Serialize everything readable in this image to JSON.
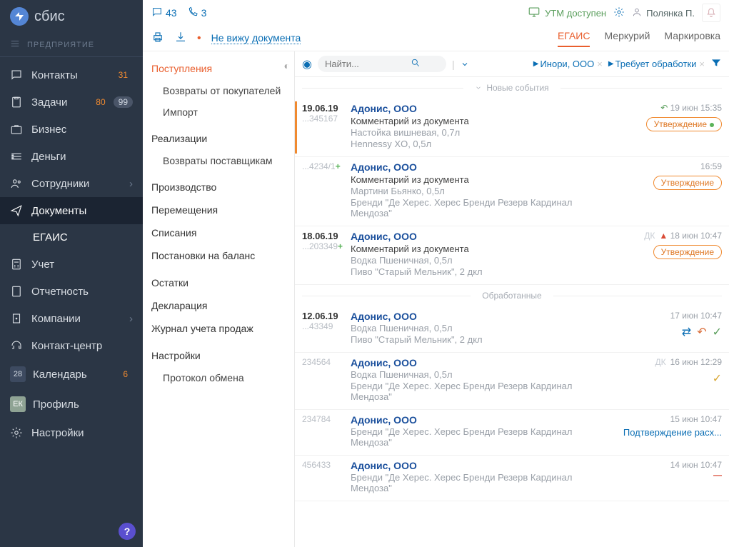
{
  "brand": "сбис",
  "enterprise_label": "ПРЕДПРИЯТИЕ",
  "sidebar": {
    "items": [
      {
        "label": "Контакты",
        "badge_orange": "31"
      },
      {
        "label": "Задачи",
        "badge_orange": "80",
        "badge_gray": "99"
      },
      {
        "label": "Бизнес"
      },
      {
        "label": "Деньги"
      },
      {
        "label": "Сотрудники",
        "chev": true
      },
      {
        "label": "Документы",
        "active_sub": "ЕГАИС"
      },
      {
        "label": "Учет"
      },
      {
        "label": "Отчетность"
      },
      {
        "label": "Компании",
        "chev": true
      },
      {
        "label": "Контакт-центр"
      },
      {
        "label": "Календарь",
        "cal": "28",
        "badge_orange": "6"
      },
      {
        "label": "Профиль",
        "avatar": "ЕК"
      },
      {
        "label": "Настройки"
      }
    ],
    "help": "?"
  },
  "topbar": {
    "chat_count": "43",
    "call_count": "3",
    "utm": "УТМ доступен",
    "user": "Полянка П."
  },
  "secondbar": {
    "nodoc": "Не вижу документа",
    "tabs": [
      "ЕГАИС",
      "Меркурий",
      "Маркировка"
    ]
  },
  "midnav": {
    "g1": "Поступления",
    "g1_subs": [
      "Возвраты от покупателей",
      "Импорт"
    ],
    "g2": "Реализации",
    "g2_subs": [
      "Возвраты поставщикам"
    ],
    "others": [
      "Производство",
      "Перемещения",
      "Списания",
      "Постановки на баланс",
      "Остатки",
      "Декларация",
      "Журнал учета продаж"
    ],
    "g3": "Настройки",
    "g3_subs": [
      "Протокол обмена"
    ]
  },
  "filter": {
    "search_placeholder": "Найти...",
    "org": "Инори, ООО",
    "state": "Требует обработки"
  },
  "sections": {
    "new": "Новые события",
    "done": "Обработанные"
  },
  "docs_new": [
    {
      "date": "19.06.19",
      "num": "...345167",
      "company": "Адонис, ООО",
      "comment": "Комментарий из документа",
      "p1": "Настойка вишневая, 0,7л",
      "p2": "Hennessy XO, 0,5л",
      "time": "19 июн 15:35",
      "pill": "Утверждение",
      "pilldot": true,
      "stripe": true,
      "undo": true
    },
    {
      "date": "",
      "num": "...4234/1",
      "plus": true,
      "company": "Адонис, ООО",
      "comment": "Комментарий из документа",
      "p1": "Мартини Бьянко, 0,5л",
      "p2": "Бренди \"Де Херес. Херес Бренди Резерв Кардинал Мендоза\"",
      "time": "16:59",
      "pill": "Утверждение"
    },
    {
      "date": "18.06.19",
      "num": "...203349",
      "plus": true,
      "company": "Адонис, ООО",
      "comment": "Комментарий из документа",
      "p1": "Водка Пшеничная, 0,5л",
      "p2": "Пиво \"Старый Мельник\", 2 дкл",
      "time": "18 июн 10:47",
      "pill": "Утверждение",
      "dk": "ДК",
      "warn": true
    }
  ],
  "docs_done": [
    {
      "date": "12.06.19",
      "num": "...43349",
      "dot": true,
      "company": "Адонис, ООО",
      "p1": "Водка Пшеничная, 0,5л",
      "p2": "Пиво \"Старый Мельник\", 2 дкл",
      "time": "17 июн 10:47",
      "actions": true
    },
    {
      "date": "",
      "num": "234564",
      "company": "Адонис, ООО",
      "p1": "Водка Пшеничная, 0,5л",
      "p2": "Бренди \"Де Херес. Херес Бренди Резерв Кардинал Мендоза\"",
      "time": "16 июн 12:29",
      "dk": "ДК",
      "check": true
    },
    {
      "date": "",
      "num": "234784",
      "company": "Адонис, ООО",
      "p2": "Бренди \"Де Херес. Херес Бренди Резерв Кардинал Мендоза\"",
      "time": "15 июн 10:47",
      "substatus": "Подтверждение расх..."
    },
    {
      "date": "",
      "num": "456433",
      "company": "Адонис, ООО",
      "p2": "Бренди \"Де Херес. Херес Бренди Резерв Кардинал Мендоза\"",
      "time": "14 июн 10:47",
      "minus": true
    }
  ]
}
